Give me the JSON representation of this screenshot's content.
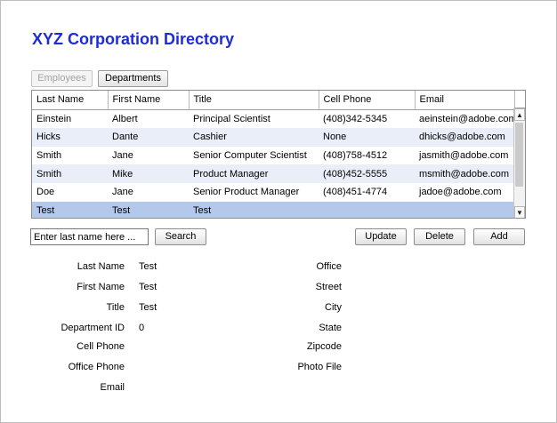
{
  "title": "XYZ Corporation Directory",
  "tabs": {
    "employees": "Employees",
    "departments": "Departments"
  },
  "table": {
    "columns": [
      "Last Name",
      "First Name",
      "Title",
      "Cell Phone",
      "Email"
    ],
    "rows": [
      [
        "Einstein",
        "Albert",
        "Principal Scientist",
        "(408)342-5345",
        "aeinstein@adobe.com"
      ],
      [
        "Hicks",
        "Dante",
        "Cashier",
        "None",
        "dhicks@adobe.com"
      ],
      [
        "Smith",
        "Jane",
        "Senior Computer Scientist",
        "(408)758-4512",
        "jasmith@adobe.com"
      ],
      [
        "Smith",
        "Mike",
        "Product Manager",
        "(408)452-5555",
        "msmith@adobe.com"
      ],
      [
        "Doe",
        "Jane",
        "Senior Product Manager",
        "(408)451-4774",
        "jadoe@adobe.com"
      ],
      [
        "Test",
        "Test",
        "Test",
        "",
        ""
      ]
    ],
    "selected_row": 5
  },
  "search": {
    "placeholder": "Enter last name here ...",
    "button": "Search"
  },
  "actions": {
    "update": "Update",
    "delete": "Delete",
    "add": "Add"
  },
  "details_left": [
    {
      "label": "Last Name",
      "value": "Test"
    },
    {
      "label": "First Name",
      "value": "Test"
    },
    {
      "label": "Title",
      "value": "Test"
    },
    {
      "label": "Department ID",
      "value": "0"
    },
    {
      "label": "Cell Phone",
      "value": ""
    },
    {
      "label": "Office Phone",
      "value": ""
    },
    {
      "label": "Email",
      "value": ""
    }
  ],
  "details_right": [
    {
      "label": "Office",
      "value": ""
    },
    {
      "label": "Street",
      "value": ""
    },
    {
      "label": "City",
      "value": ""
    },
    {
      "label": "State",
      "value": ""
    },
    {
      "label": "Zipcode",
      "value": ""
    },
    {
      "label": "Photo File",
      "value": ""
    }
  ],
  "scroll_icons": {
    "up": "▲",
    "down": "▼"
  },
  "colors": {
    "title": "#1f2bd6",
    "selected_row": "#b3c8eb",
    "alt_row": "#e9eef8"
  }
}
